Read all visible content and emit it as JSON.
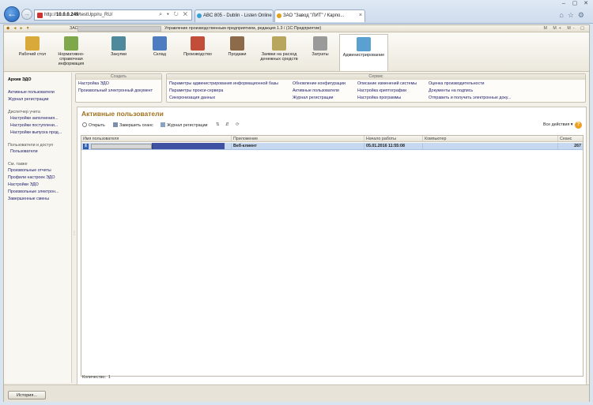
{
  "browser": {
    "url_host": "10.0.0.249",
    "url_rest": "/testUpp/ru_RU/",
    "url_prefix": "http://",
    "tabs": [
      {
        "label": "ABC 805 - Dublin - Listen Online"
      },
      {
        "label": "ЗАО \"Завод \"ЛИТ\" / Карпо..."
      }
    ],
    "window_buttons": [
      "–",
      "▢",
      "✕"
    ]
  },
  "app": {
    "base_label": "ЗАО",
    "title": "Управление производственным предприятием, редакция 1.3 / (1С:Предприятие)",
    "right_tools": "М  М+  М-  ▢"
  },
  "sections": [
    {
      "label": "Рабочий стол",
      "color": "#d9a93a"
    },
    {
      "label": "Нормативно-справочная информация",
      "color": "#7fa84a"
    },
    {
      "label": "Закупки",
      "color": "#4f8a9c"
    },
    {
      "label": "Склад",
      "color": "#4d7cc0"
    },
    {
      "label": "Производство",
      "color": "#c24e3a"
    },
    {
      "label": "Продажи",
      "color": "#8c6a4a"
    },
    {
      "label": "Заявки на расход денежных средств",
      "color": "#b8a65e"
    },
    {
      "label": "Затраты",
      "color": "#9a9a9a"
    },
    {
      "label": "Администрирование",
      "color": "#5aa0d0",
      "active": true
    }
  ],
  "left_panel": {
    "title": "Архив ЭДО",
    "links1": [
      "Активные пользователи",
      "Журнал регистрации"
    ],
    "group1": "Диспетчер учета",
    "group1_items": [
      "Настройки заполнения...",
      "Настройки поступлени...",
      "Настройки выпуска прод..."
    ],
    "group2": "Пользователи и доступ",
    "group2_items": [
      "Пользователи"
    ],
    "group3": "См. также",
    "group3_items": [
      "Произвольные отчеты",
      "Профили настроек ЭДО",
      "Настройки ЭДО",
      "Произвольные электрон...",
      "Завершенные смены"
    ]
  },
  "commands": {
    "create_header": "Создать",
    "create_items": [
      "Настройка ЭДО",
      "Произвольный электронный документ"
    ],
    "service_header": "Сервис",
    "service_col1": [
      "Параметры администрирования информационной базы",
      "Параметры прокси-сервера",
      "Синхронизация данных"
    ],
    "service_col2": [
      "Обновление конфигурации",
      "Активные пользователи",
      "Журнал регистрации"
    ],
    "service_col3": [
      "Описание изменений системы",
      "Настройка криптографии",
      "Настройка программы"
    ],
    "service_col4": [
      "Оценка производительности",
      "Документы на подпись",
      "Отправить и получить электронные доку..."
    ]
  },
  "workarea": {
    "title": "Активные пользователи",
    "toolbar": {
      "open": "Открыть",
      "end_session": "Завершить сеанс",
      "log": "Журнал регистрации",
      "all_actions": "Все действия",
      "help": "?"
    },
    "columns": [
      "Имя пользователя",
      "Приложение",
      "Начало работы",
      "Компьютер",
      "Сеанс"
    ],
    "rows": [
      {
        "app": "Веб-клиент",
        "start": "05.01.2016 11:55:08",
        "computer": "",
        "session": "267"
      }
    ],
    "count_label": "Количество:",
    "count_value": "1"
  },
  "status": {
    "history": "История..."
  }
}
